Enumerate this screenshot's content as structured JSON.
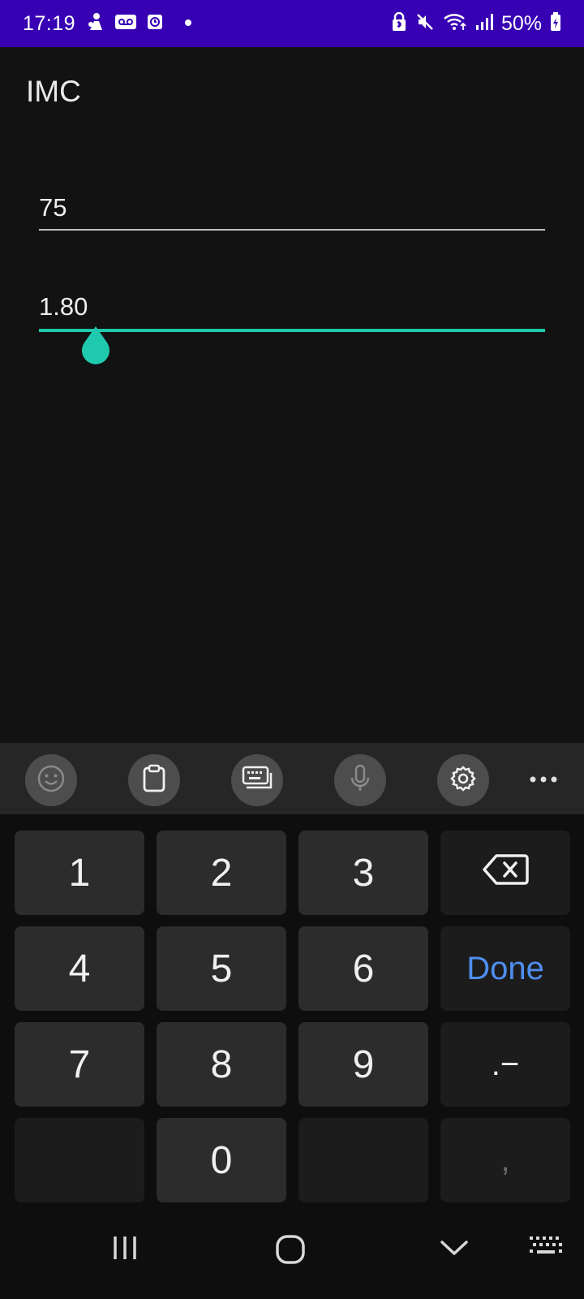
{
  "status_bar": {
    "time": "17:19",
    "battery": "50%",
    "background": "#3700b3",
    "icons_left": [
      "person-icon",
      "voicemail-icon",
      "clock-badge-icon",
      "dot-icon"
    ],
    "icons_right": [
      "bluetooth-lock-icon",
      "mute-icon",
      "wifi-icon",
      "signal-icon",
      "battery-icon"
    ]
  },
  "app": {
    "title": "IMC",
    "weight_value": "75",
    "height_value": "1.80",
    "accent": "#1fc9ae"
  },
  "keyboard_toolbar": {
    "buttons": [
      "emoji-icon",
      "clipboard-icon",
      "keyboard-mode-icon",
      "microphone-icon",
      "settings-icon",
      "more-icon"
    ]
  },
  "keypad": {
    "row1": [
      "1",
      "2",
      "3"
    ],
    "row2": [
      "4",
      "5",
      "6"
    ],
    "row3": [
      "7",
      "8",
      "9"
    ],
    "zero": "0",
    "done": "Done",
    "dot_dash": ".−",
    "comma": ",",
    "done_color": "#4f8ef0"
  },
  "nav_bar": {
    "buttons": [
      "recents-icon",
      "home-icon",
      "back-chevron-icon",
      "keyboard-switch-icon"
    ]
  }
}
